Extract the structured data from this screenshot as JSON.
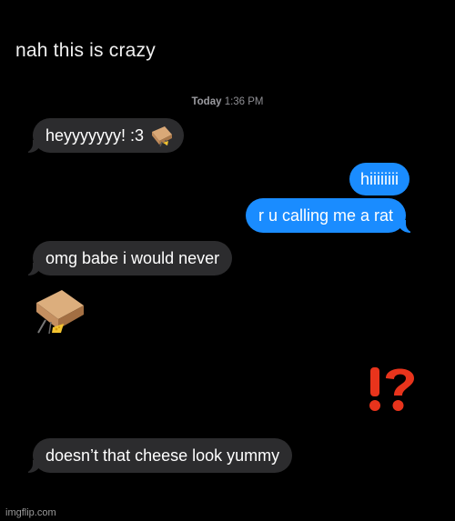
{
  "caption": "nah this is crazy",
  "timestamp": {
    "day": "Today",
    "time": "1:36 PM"
  },
  "messages": [
    {
      "side": "received",
      "text": "heyyyyyyy! :3"
    },
    {
      "side": "sent",
      "text": "hiiiiiiii"
    },
    {
      "side": "sent",
      "text": "r u calling me a rat"
    },
    {
      "side": "received",
      "text": "omg babe i would never"
    },
    {
      "side": "received",
      "text": "doesn’t that cheese look yummy"
    }
  ],
  "reaction_glyph": "!?",
  "icons": [
    "rat-trap-emoji-icon",
    "rat-trap-sticker-icon",
    "interrobang-icon"
  ],
  "colors": {
    "sent_bubble": "#1a8cff",
    "received_bubble": "#2c2c2e",
    "interrobang": "#e8341c"
  },
  "watermark": "imgflip.com"
}
